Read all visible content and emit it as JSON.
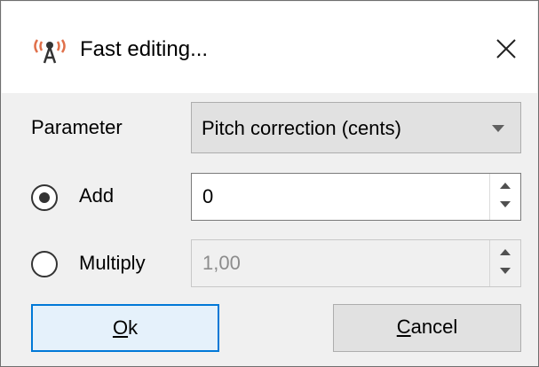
{
  "window": {
    "title": "Fast editing...",
    "icon": "antenna-icon",
    "close_icon": "close-icon"
  },
  "parameter": {
    "label": "Parameter",
    "selected": "Pitch correction (cents)"
  },
  "mode": {
    "add": {
      "label": "Add",
      "checked": true,
      "value": "0"
    },
    "multiply": {
      "label": "Multiply",
      "checked": false,
      "value": "1,00",
      "disabled": true
    }
  },
  "buttons": {
    "ok": {
      "accel": "O",
      "rest": "k"
    },
    "cancel": {
      "accel": "C",
      "rest": "ancel"
    }
  },
  "colors": {
    "accent": "#0078d7",
    "icon_red": "#d9534f",
    "icon_dark": "#333333"
  }
}
